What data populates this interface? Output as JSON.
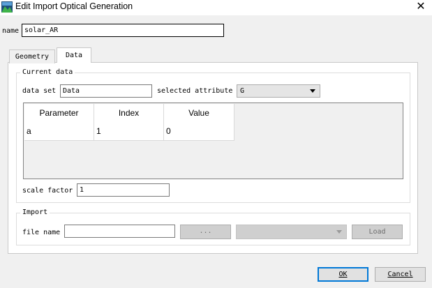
{
  "window": {
    "title": "Edit Import Optical Generation",
    "icon": "app-icon",
    "close_glyph": "✕"
  },
  "name": {
    "label": "name",
    "value": "solar_AR"
  },
  "tabs": [
    {
      "label": "Geometry"
    },
    {
      "label": "Data",
      "selected": true
    }
  ],
  "current_data": {
    "title": "Current data",
    "dataset_label": "data set",
    "dataset_value": "Data",
    "attribute_label": "selected attribute",
    "attribute_value": "G"
  },
  "table": {
    "columns": [
      "Parameter",
      "Index",
      "Value"
    ],
    "rows": [
      [
        "a",
        "1",
        "0"
      ]
    ]
  },
  "scale": {
    "label": "scale factor",
    "value": "1"
  },
  "import": {
    "title": "Import",
    "file_label": "file name",
    "file_value": "",
    "browse_label": "...",
    "load_label": "Load"
  },
  "buttons": {
    "ok_label": "OK",
    "cancel_label": "Cancel"
  },
  "colors": {
    "accent": "#0078d7",
    "disabled_bg": "#cfcfcf"
  }
}
